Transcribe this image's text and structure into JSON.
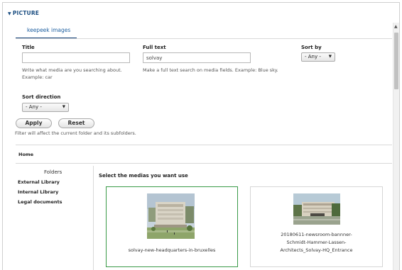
{
  "section": {
    "title": "PICTURE"
  },
  "tabs": [
    {
      "label": "keepeek images"
    }
  ],
  "filters": {
    "title": {
      "label": "Title",
      "value": "",
      "help": "Write what media are you searching about. Example: car"
    },
    "full_text": {
      "label": "Full text",
      "value": "solvay",
      "help": "Make a full text search on media fields. Example: Blue sky."
    },
    "sort_by": {
      "label": "Sort by",
      "value": "- Any -"
    },
    "sort_direction": {
      "label": "Sort direction",
      "value": "- Any -"
    }
  },
  "buttons": {
    "apply": "Apply",
    "reset": "Reset"
  },
  "filter_note": "Filter will affect the current folder and its subfolders.",
  "breadcrumb": {
    "home": "Home"
  },
  "folders": {
    "heading": "Folders",
    "items": [
      "External Library",
      "Internal Library",
      "Legal documents"
    ]
  },
  "media": {
    "heading": "Select the medias you want use",
    "items": [
      {
        "caption": "solvay-new-headquarters-in-bruxelles",
        "selected": true
      },
      {
        "caption_lines": [
          "20180611-newsroom-bannner-",
          "Schmidt-Hammer-Lassen-",
          "Architects_Solvay-HQ_Entrance"
        ],
        "selected": false
      }
    ]
  },
  "colors": {
    "accent": "#1d5fa0",
    "tab_underline": "#0f3d75",
    "selected_border": "#3a9a48"
  }
}
